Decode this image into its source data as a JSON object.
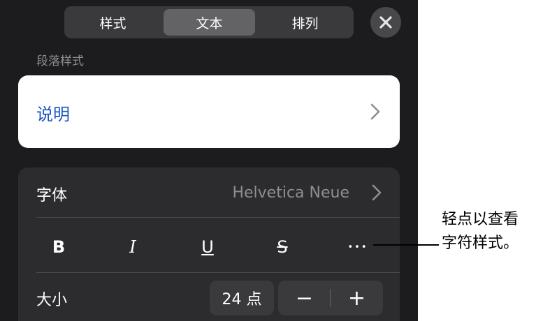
{
  "tabs": [
    {
      "label": "样式"
    },
    {
      "label": "文本",
      "selected": true
    },
    {
      "label": "排列"
    }
  ],
  "close_icon": "close-icon",
  "paragraph_style": {
    "section_label": "段落样式",
    "value": "说明"
  },
  "font_row": {
    "label": "字体",
    "value": "Helvetica Neue"
  },
  "style_buttons": {
    "bold": "B",
    "italic": "I",
    "underline": "U",
    "strikethrough": "S",
    "more": "•••"
  },
  "size_row": {
    "label": "大小",
    "value": "24 点",
    "decrease": "−",
    "increase": "+"
  },
  "callout": {
    "text": "轻点以查看\n字符样式。"
  },
  "colors": {
    "panel_bg": "#1c1c1e",
    "accent_blue": "#1a56c4",
    "secondary_text": "#8e8e93"
  }
}
